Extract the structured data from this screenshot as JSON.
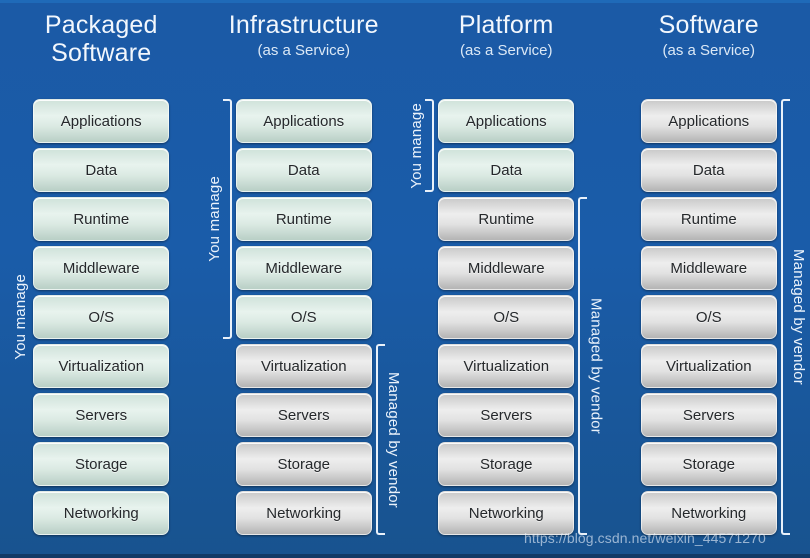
{
  "diagram": {
    "layer_names": [
      "Applications",
      "Data",
      "Runtime",
      "Middleware",
      "O/S",
      "Virtualization",
      "Servers",
      "Storage",
      "Networking"
    ],
    "labels": {
      "you_manage": "You manage",
      "managed_by_vendor": "Managed by vendor"
    },
    "colors": {
      "background_blue": "#1a5aa6",
      "self_managed_green": "#dbeae3",
      "vendor_managed_gray": "#e2e2e2",
      "title_text": "#f2f7fd"
    },
    "watermark": "https://blog.csdn.net/weixin_44571270",
    "columns": [
      {
        "id": "packaged-software",
        "title": "Packaged",
        "title_line2": "Software",
        "subtitle": "",
        "layers": [
          {
            "name": "Applications",
            "managed_by": "self"
          },
          {
            "name": "Data",
            "managed_by": "self"
          },
          {
            "name": "Runtime",
            "managed_by": "self"
          },
          {
            "name": "Middleware",
            "managed_by": "self"
          },
          {
            "name": "O/S",
            "managed_by": "self"
          },
          {
            "name": "Virtualization",
            "managed_by": "self"
          },
          {
            "name": "Servers",
            "managed_by": "self"
          },
          {
            "name": "Storage",
            "managed_by": "self"
          },
          {
            "name": "Networking",
            "managed_by": "self"
          }
        ],
        "you_manage_range": [
          0,
          8
        ],
        "vendor_range": null
      },
      {
        "id": "infrastructure-as-a-service",
        "title": "Infrastructure",
        "title_line2": "",
        "subtitle": "(as a Service)",
        "layers": [
          {
            "name": "Applications",
            "managed_by": "self"
          },
          {
            "name": "Data",
            "managed_by": "self"
          },
          {
            "name": "Runtime",
            "managed_by": "self"
          },
          {
            "name": "Middleware",
            "managed_by": "self"
          },
          {
            "name": "O/S",
            "managed_by": "self"
          },
          {
            "name": "Virtualization",
            "managed_by": "vendor"
          },
          {
            "name": "Servers",
            "managed_by": "vendor"
          },
          {
            "name": "Storage",
            "managed_by": "vendor"
          },
          {
            "name": "Networking",
            "managed_by": "vendor"
          }
        ],
        "you_manage_range": [
          0,
          4
        ],
        "vendor_range": [
          5,
          8
        ]
      },
      {
        "id": "platform-as-a-service",
        "title": "Platform",
        "title_line2": "",
        "subtitle": "(as a Service)",
        "layers": [
          {
            "name": "Applications",
            "managed_by": "self"
          },
          {
            "name": "Data",
            "managed_by": "self"
          },
          {
            "name": "Runtime",
            "managed_by": "vendor"
          },
          {
            "name": "Middleware",
            "managed_by": "vendor"
          },
          {
            "name": "O/S",
            "managed_by": "vendor"
          },
          {
            "name": "Virtualization",
            "managed_by": "vendor"
          },
          {
            "name": "Servers",
            "managed_by": "vendor"
          },
          {
            "name": "Storage",
            "managed_by": "vendor"
          },
          {
            "name": "Networking",
            "managed_by": "vendor"
          }
        ],
        "you_manage_range": [
          0,
          1
        ],
        "vendor_range": [
          2,
          8
        ]
      },
      {
        "id": "software-as-a-service",
        "title": "Software",
        "title_line2": "",
        "subtitle": "(as a Service)",
        "layers": [
          {
            "name": "Applications",
            "managed_by": "vendor"
          },
          {
            "name": "Data",
            "managed_by": "vendor"
          },
          {
            "name": "Runtime",
            "managed_by": "vendor"
          },
          {
            "name": "Middleware",
            "managed_by": "vendor"
          },
          {
            "name": "O/S",
            "managed_by": "vendor"
          },
          {
            "name": "Virtualization",
            "managed_by": "vendor"
          },
          {
            "name": "Servers",
            "managed_by": "vendor"
          },
          {
            "name": "Storage",
            "managed_by": "vendor"
          },
          {
            "name": "Networking",
            "managed_by": "vendor"
          }
        ],
        "you_manage_range": null,
        "vendor_range": [
          0,
          8
        ]
      }
    ]
  }
}
